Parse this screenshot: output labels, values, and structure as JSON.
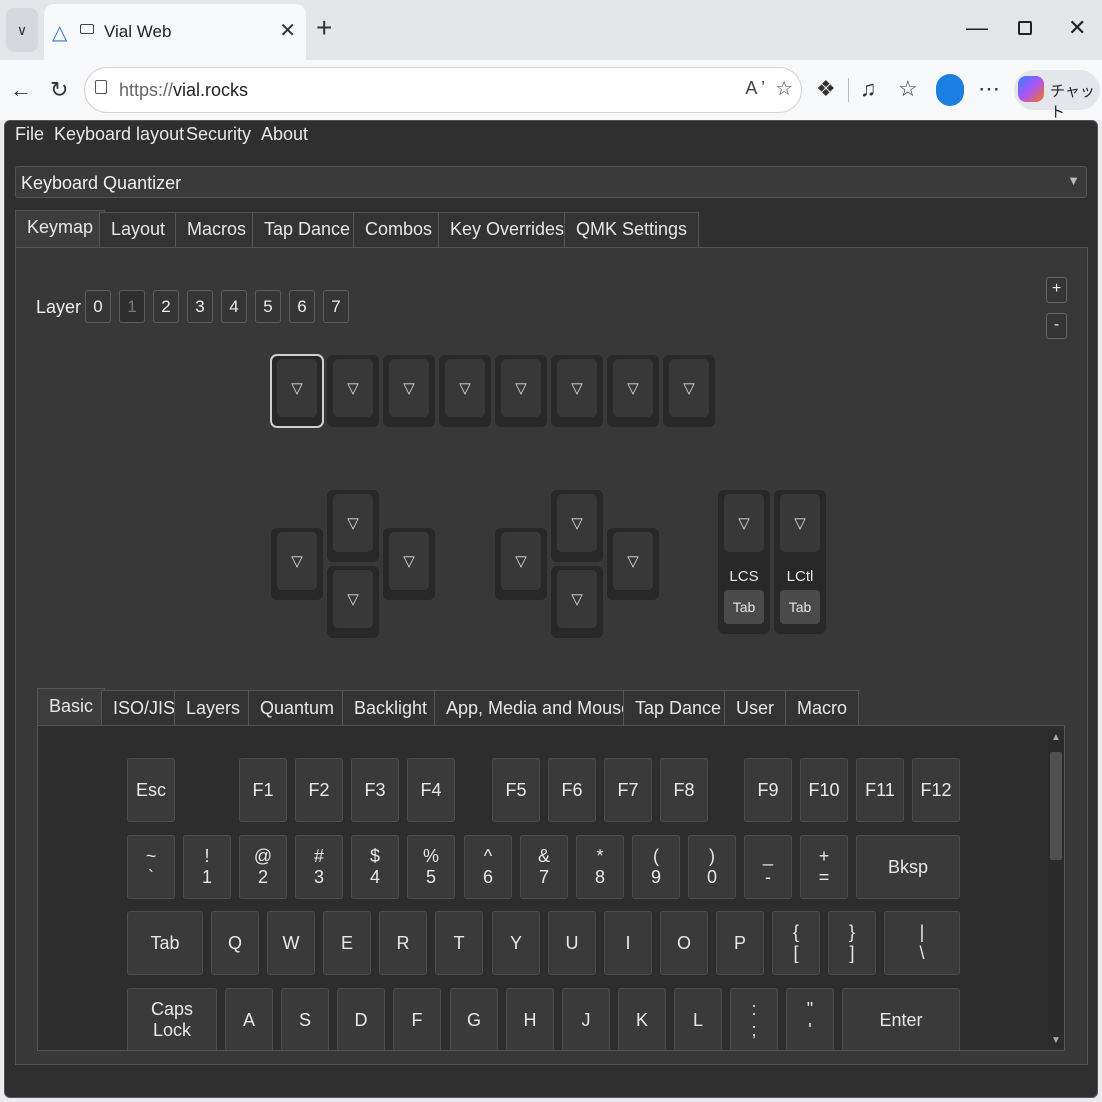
{
  "browser": {
    "tab_title": "Vial Web",
    "url_prefix": "https://",
    "url_host": "vial.rocks",
    "read_aloud": "A)",
    "copilot_label": "チャット"
  },
  "menu": [
    "File",
    "Keyboard layout",
    "Security",
    "About"
  ],
  "keyboard_select": "Keyboard Quantizer",
  "main_tabs": [
    "Keymap",
    "Layout",
    "Macros",
    "Tap Dance",
    "Combos",
    "Key Overrides",
    "QMK Settings"
  ],
  "layer": {
    "label": "Layer",
    "buttons": [
      "0",
      "1",
      "2",
      "3",
      "4",
      "5",
      "6",
      "7"
    ],
    "plus": "+",
    "minus": "-"
  },
  "keymap_glyph": "▽",
  "special_keys": [
    {
      "top": "LCS",
      "bottom": "Tab"
    },
    {
      "top": "LCtl",
      "bottom": "Tab"
    }
  ],
  "sub_tabs": [
    "Basic",
    "ISO/JIS",
    "Layers",
    "Quantum",
    "Backlight",
    "App, Media and Mouse",
    "Tap Dance",
    "User",
    "Macro"
  ],
  "basic_keys": {
    "row1": [
      "Esc",
      "F1",
      "F2",
      "F3",
      "F4",
      "F5",
      "F6",
      "F7",
      "F8",
      "F9",
      "F10",
      "F11",
      "F12"
    ],
    "row2": [
      [
        "~",
        "`"
      ],
      [
        "!",
        "1"
      ],
      [
        "@",
        "2"
      ],
      [
        "#",
        "3"
      ],
      [
        "$",
        "4"
      ],
      [
        "%",
        "5"
      ],
      [
        "^",
        "6"
      ],
      [
        "&",
        "7"
      ],
      [
        "*",
        "8"
      ],
      [
        "(",
        "9"
      ],
      [
        ")",
        "0"
      ],
      [
        "_",
        "-"
      ],
      [
        "+",
        "="
      ],
      [
        "Bksp",
        ""
      ]
    ],
    "row3": [
      "Tab",
      "Q",
      "W",
      "E",
      "R",
      "T",
      "Y",
      "U",
      "I",
      "O",
      "P",
      "{\n[",
      "}\n]",
      "|\n\\"
    ],
    "row4": [
      "Caps\nLock",
      "A",
      "S",
      "D",
      "F",
      "G",
      "H",
      "J",
      "K",
      "L",
      ":\n;",
      "\"\n'",
      "Enter"
    ]
  }
}
